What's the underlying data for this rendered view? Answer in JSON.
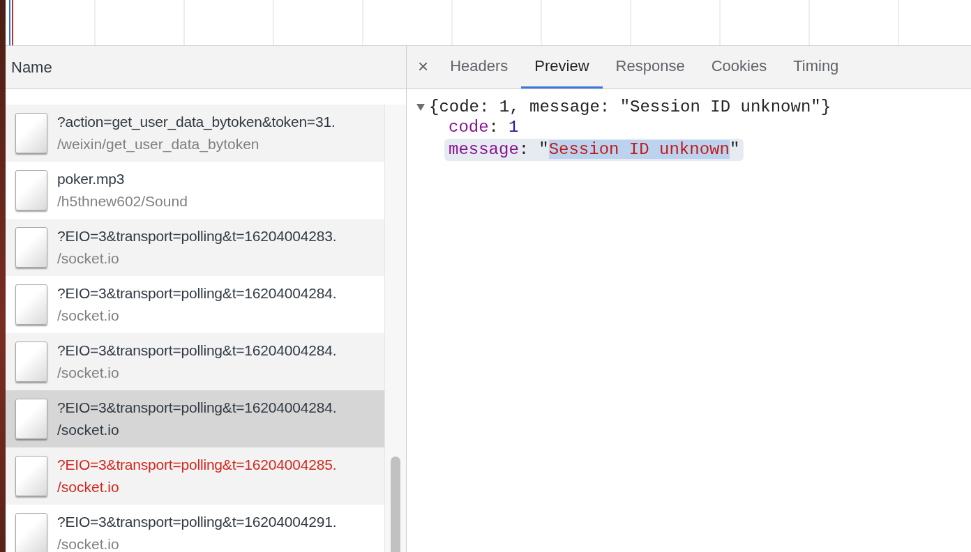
{
  "requests": {
    "column_header": "Name",
    "rows": [
      {
        "name": "?action=get_user_data_bytoken&token=31.",
        "path": "/weixin/get_user_data_bytoken",
        "selected": false,
        "error": false
      },
      {
        "name": "poker.mp3",
        "path": "/h5thnew602/Sound",
        "selected": false,
        "error": false
      },
      {
        "name": "?EIO=3&transport=polling&t=16204004283.",
        "path": "/socket.io",
        "selected": false,
        "error": false
      },
      {
        "name": "?EIO=3&transport=polling&t=16204004284.",
        "path": "/socket.io",
        "selected": false,
        "error": false
      },
      {
        "name": "?EIO=3&transport=polling&t=16204004284.",
        "path": "/socket.io",
        "selected": false,
        "error": false
      },
      {
        "name": "?EIO=3&transport=polling&t=16204004284.",
        "path": "/socket.io",
        "selected": true,
        "error": false
      },
      {
        "name": "?EIO=3&transport=polling&t=16204004285.",
        "path": "/socket.io",
        "selected": false,
        "error": true
      },
      {
        "name": "?EIO=3&transport=polling&t=16204004291.",
        "path": "/socket.io",
        "selected": false,
        "error": false
      }
    ]
  },
  "details": {
    "close": "×",
    "tabs": [
      {
        "label": "Headers",
        "selected": false
      },
      {
        "label": "Preview",
        "selected": true
      },
      {
        "label": "Response",
        "selected": false
      },
      {
        "label": "Cookies",
        "selected": false
      },
      {
        "label": "Timing",
        "selected": false
      }
    ],
    "preview": {
      "expanded": true,
      "summary": "{code: 1, message: \"Session ID unknown\"}",
      "properties": [
        {
          "key": "code",
          "separator": ":",
          "kind": "number",
          "value": "1",
          "selected": false
        },
        {
          "key": "message",
          "separator": ":",
          "kind": "string",
          "open_quote": "\"",
          "value": "Session ID unknown",
          "close_quote": "\"",
          "selected": true
        }
      ]
    }
  }
}
